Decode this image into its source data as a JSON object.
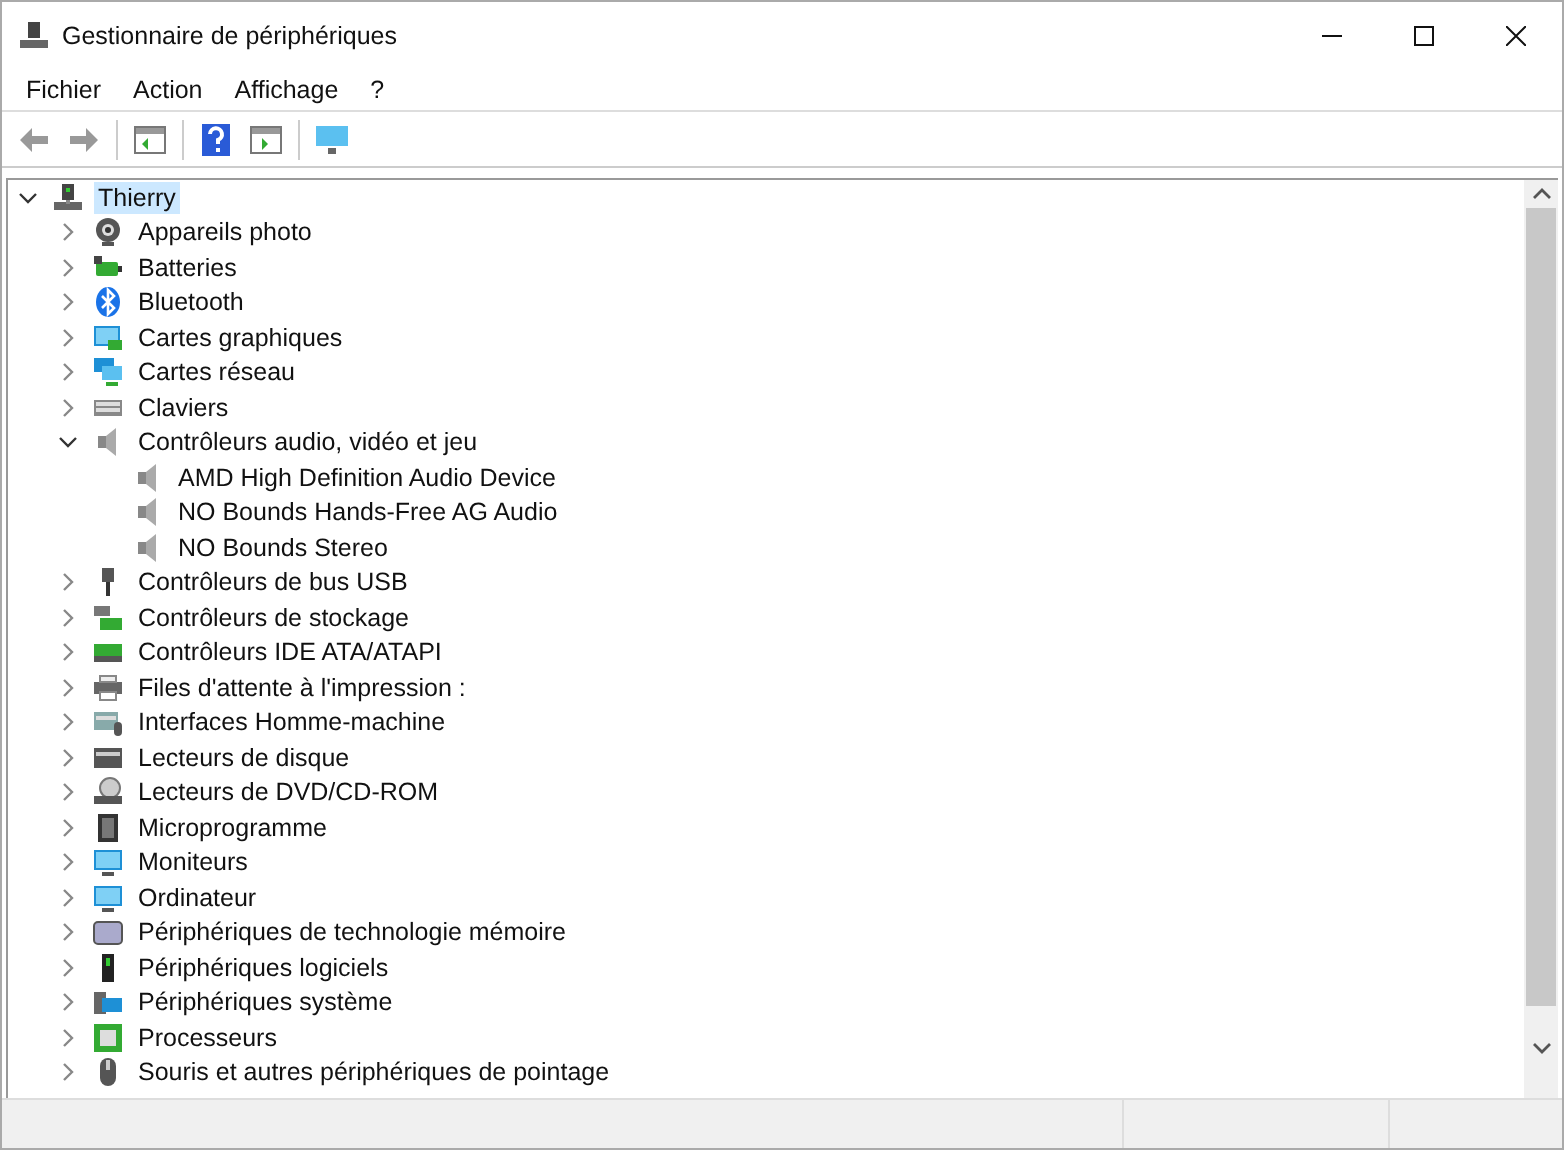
{
  "window": {
    "title": "Gestionnaire de périphériques"
  },
  "menu": [
    {
      "label": "Fichier"
    },
    {
      "label": "Action"
    },
    {
      "label": "Affichage"
    },
    {
      "label": "?"
    }
  ],
  "tree": {
    "label": "Thierry",
    "selected": true,
    "expanded": true,
    "children": [
      {
        "label": "Appareils photo",
        "expanded": false
      },
      {
        "label": "Batteries",
        "expanded": false
      },
      {
        "label": "Bluetooth",
        "expanded": false
      },
      {
        "label": "Cartes graphiques",
        "expanded": false
      },
      {
        "label": "Cartes réseau",
        "expanded": false
      },
      {
        "label": "Claviers",
        "expanded": false
      },
      {
        "label": "Contrôleurs audio, vidéo et jeu",
        "expanded": true,
        "children": [
          {
            "label": "AMD High Definition Audio Device"
          },
          {
            "label": "NO Bounds Hands-Free AG Audio"
          },
          {
            "label": "NO Bounds Stereo"
          }
        ]
      },
      {
        "label": "Contrôleurs de bus USB",
        "expanded": false
      },
      {
        "label": "Contrôleurs de stockage",
        "expanded": false
      },
      {
        "label": "Contrôleurs IDE ATA/ATAPI",
        "expanded": false
      },
      {
        "label": "Files d'attente à l'impression :",
        "expanded": false
      },
      {
        "label": "Interfaces Homme-machine",
        "expanded": false
      },
      {
        "label": "Lecteurs de disque",
        "expanded": false
      },
      {
        "label": "Lecteurs de DVD/CD-ROM",
        "expanded": false
      },
      {
        "label": "Microprogramme",
        "expanded": false
      },
      {
        "label": "Moniteurs",
        "expanded": false
      },
      {
        "label": "Ordinateur",
        "expanded": false
      },
      {
        "label": "Périphériques de technologie mémoire",
        "expanded": false
      },
      {
        "label": "Périphériques logiciels",
        "expanded": false
      },
      {
        "label": "Périphériques système",
        "expanded": false
      },
      {
        "label": "Processeurs",
        "expanded": false
      },
      {
        "label": "Souris et autres périphériques de pointage",
        "expanded": false
      }
    ]
  }
}
